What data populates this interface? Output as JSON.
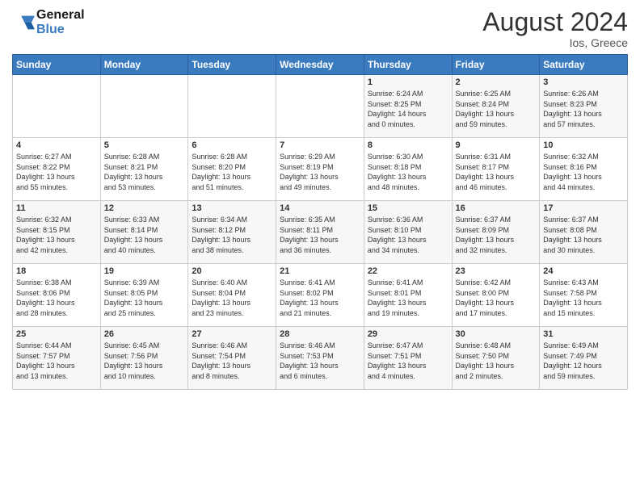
{
  "header": {
    "logo_text_general": "General",
    "logo_text_blue": "Blue",
    "month_year": "August 2024",
    "location": "Ios, Greece"
  },
  "calendar": {
    "days_of_week": [
      "Sunday",
      "Monday",
      "Tuesday",
      "Wednesday",
      "Thursday",
      "Friday",
      "Saturday"
    ],
    "weeks": [
      [
        {
          "day": "",
          "info": ""
        },
        {
          "day": "",
          "info": ""
        },
        {
          "day": "",
          "info": ""
        },
        {
          "day": "",
          "info": ""
        },
        {
          "day": "1",
          "info": "Sunrise: 6:24 AM\nSunset: 8:25 PM\nDaylight: 14 hours\nand 0 minutes."
        },
        {
          "day": "2",
          "info": "Sunrise: 6:25 AM\nSunset: 8:24 PM\nDaylight: 13 hours\nand 59 minutes."
        },
        {
          "day": "3",
          "info": "Sunrise: 6:26 AM\nSunset: 8:23 PM\nDaylight: 13 hours\nand 57 minutes."
        }
      ],
      [
        {
          "day": "4",
          "info": "Sunrise: 6:27 AM\nSunset: 8:22 PM\nDaylight: 13 hours\nand 55 minutes."
        },
        {
          "day": "5",
          "info": "Sunrise: 6:28 AM\nSunset: 8:21 PM\nDaylight: 13 hours\nand 53 minutes."
        },
        {
          "day": "6",
          "info": "Sunrise: 6:28 AM\nSunset: 8:20 PM\nDaylight: 13 hours\nand 51 minutes."
        },
        {
          "day": "7",
          "info": "Sunrise: 6:29 AM\nSunset: 8:19 PM\nDaylight: 13 hours\nand 49 minutes."
        },
        {
          "day": "8",
          "info": "Sunrise: 6:30 AM\nSunset: 8:18 PM\nDaylight: 13 hours\nand 48 minutes."
        },
        {
          "day": "9",
          "info": "Sunrise: 6:31 AM\nSunset: 8:17 PM\nDaylight: 13 hours\nand 46 minutes."
        },
        {
          "day": "10",
          "info": "Sunrise: 6:32 AM\nSunset: 8:16 PM\nDaylight: 13 hours\nand 44 minutes."
        }
      ],
      [
        {
          "day": "11",
          "info": "Sunrise: 6:32 AM\nSunset: 8:15 PM\nDaylight: 13 hours\nand 42 minutes."
        },
        {
          "day": "12",
          "info": "Sunrise: 6:33 AM\nSunset: 8:14 PM\nDaylight: 13 hours\nand 40 minutes."
        },
        {
          "day": "13",
          "info": "Sunrise: 6:34 AM\nSunset: 8:12 PM\nDaylight: 13 hours\nand 38 minutes."
        },
        {
          "day": "14",
          "info": "Sunrise: 6:35 AM\nSunset: 8:11 PM\nDaylight: 13 hours\nand 36 minutes."
        },
        {
          "day": "15",
          "info": "Sunrise: 6:36 AM\nSunset: 8:10 PM\nDaylight: 13 hours\nand 34 minutes."
        },
        {
          "day": "16",
          "info": "Sunrise: 6:37 AM\nSunset: 8:09 PM\nDaylight: 13 hours\nand 32 minutes."
        },
        {
          "day": "17",
          "info": "Sunrise: 6:37 AM\nSunset: 8:08 PM\nDaylight: 13 hours\nand 30 minutes."
        }
      ],
      [
        {
          "day": "18",
          "info": "Sunrise: 6:38 AM\nSunset: 8:06 PM\nDaylight: 13 hours\nand 28 minutes."
        },
        {
          "day": "19",
          "info": "Sunrise: 6:39 AM\nSunset: 8:05 PM\nDaylight: 13 hours\nand 25 minutes."
        },
        {
          "day": "20",
          "info": "Sunrise: 6:40 AM\nSunset: 8:04 PM\nDaylight: 13 hours\nand 23 minutes."
        },
        {
          "day": "21",
          "info": "Sunrise: 6:41 AM\nSunset: 8:02 PM\nDaylight: 13 hours\nand 21 minutes."
        },
        {
          "day": "22",
          "info": "Sunrise: 6:41 AM\nSunset: 8:01 PM\nDaylight: 13 hours\nand 19 minutes."
        },
        {
          "day": "23",
          "info": "Sunrise: 6:42 AM\nSunset: 8:00 PM\nDaylight: 13 hours\nand 17 minutes."
        },
        {
          "day": "24",
          "info": "Sunrise: 6:43 AM\nSunset: 7:58 PM\nDaylight: 13 hours\nand 15 minutes."
        }
      ],
      [
        {
          "day": "25",
          "info": "Sunrise: 6:44 AM\nSunset: 7:57 PM\nDaylight: 13 hours\nand 13 minutes."
        },
        {
          "day": "26",
          "info": "Sunrise: 6:45 AM\nSunset: 7:56 PM\nDaylight: 13 hours\nand 10 minutes."
        },
        {
          "day": "27",
          "info": "Sunrise: 6:46 AM\nSunset: 7:54 PM\nDaylight: 13 hours\nand 8 minutes."
        },
        {
          "day": "28",
          "info": "Sunrise: 6:46 AM\nSunset: 7:53 PM\nDaylight: 13 hours\nand 6 minutes."
        },
        {
          "day": "29",
          "info": "Sunrise: 6:47 AM\nSunset: 7:51 PM\nDaylight: 13 hours\nand 4 minutes."
        },
        {
          "day": "30",
          "info": "Sunrise: 6:48 AM\nSunset: 7:50 PM\nDaylight: 13 hours\nand 2 minutes."
        },
        {
          "day": "31",
          "info": "Sunrise: 6:49 AM\nSunset: 7:49 PM\nDaylight: 12 hours\nand 59 minutes."
        }
      ]
    ]
  }
}
